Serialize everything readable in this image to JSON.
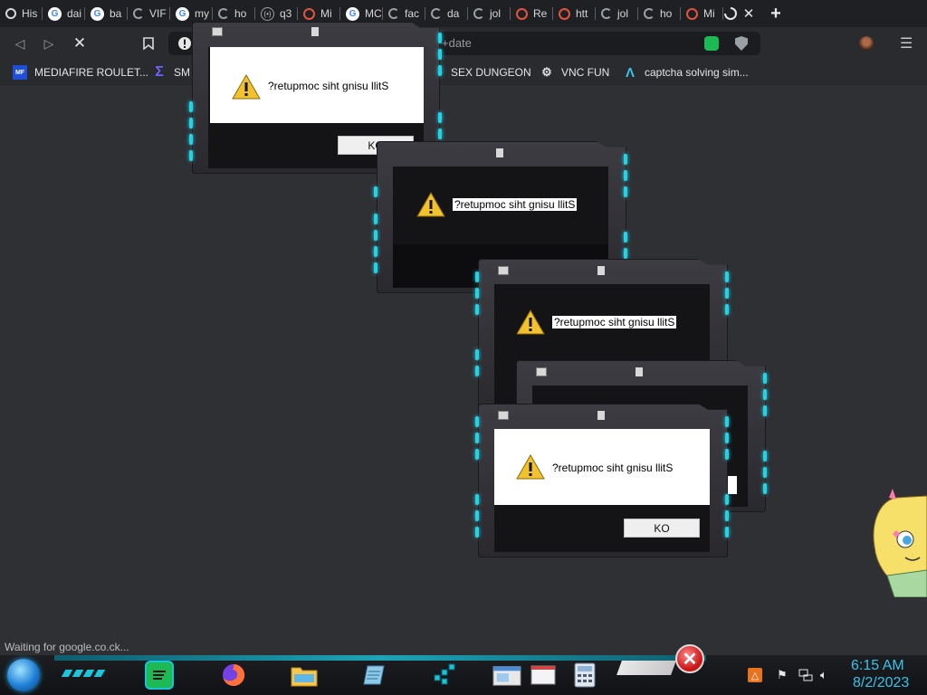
{
  "tabs": [
    {
      "label": "His",
      "icon": "history-icon",
      "kind": "hist"
    },
    {
      "label": "dai",
      "icon": "google-icon",
      "kind": "g"
    },
    {
      "label": "ba",
      "icon": "google-icon",
      "kind": "g"
    },
    {
      "label": "VIF",
      "icon": "spinner-icon",
      "kind": "sp"
    },
    {
      "label": "my",
      "icon": "google-icon",
      "kind": "g"
    },
    {
      "label": "ho",
      "icon": "spinner-icon",
      "kind": "sp"
    },
    {
      "label": "q3",
      "icon": "urban-dictionary-icon",
      "kind": "ud"
    },
    {
      "label": "Mi",
      "icon": "reddit-red-icon",
      "kind": "rr"
    },
    {
      "label": "MC",
      "icon": "google-icon",
      "kind": "g"
    },
    {
      "label": "fac",
      "icon": "spinner-icon",
      "kind": "sp"
    },
    {
      "label": "da",
      "icon": "spinner-icon",
      "kind": "sp"
    },
    {
      "label": "jol",
      "icon": "spinner-icon",
      "kind": "sp"
    },
    {
      "label": "Re",
      "icon": "reddit-red-icon",
      "kind": "rr"
    },
    {
      "label": "htt",
      "icon": "reddit-red-icon",
      "kind": "rr"
    },
    {
      "label": "jol",
      "icon": "spinner-icon",
      "kind": "sp"
    },
    {
      "label": "ho",
      "icon": "spinner-icon",
      "kind": "sp"
    },
    {
      "label": "Mi",
      "icon": "reddit-red-icon",
      "kind": "rr"
    }
  ],
  "address_partial": "+date",
  "bookmarks": [
    {
      "label": "MEDIAFIRE ROULET...",
      "icon": "mediafire-icon"
    },
    {
      "label": "SM",
      "icon": "sigma-icon"
    },
    {
      "label": "SEX DUNGEON",
      "icon": "bookmark-icon"
    },
    {
      "label": "VNC FUN",
      "icon": "vnc-icon"
    },
    {
      "label": "captcha solving sim...",
      "icon": "lambda-icon"
    }
  ],
  "dialogs": [
    {
      "message": "?retupmoc siht gnisu llitS",
      "ok": "KO"
    },
    {
      "message": "?retupmoc siht gnisu llitS"
    },
    {
      "message": "?retupmoc siht gnisu llitS"
    },
    {
      "message": "?retupmoc siht gnisu llitS",
      "ok": "KO"
    }
  ],
  "status_text": "Waiting for google.co.ck...",
  "clock": {
    "time": "6:15 AM",
    "date": "8/2/2023"
  },
  "colors": {
    "accent": "#22d3e6",
    "clock": "#38c3e8",
    "background": "#2f3034"
  }
}
